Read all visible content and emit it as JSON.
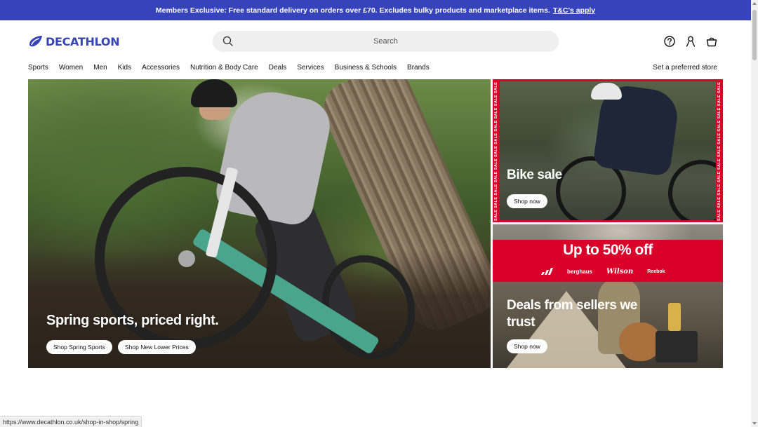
{
  "promo": {
    "text": "Members Exclusive: Free standard delivery on orders over £70. Excludes bulky products and marketplace items.",
    "link": "T&C's apply"
  },
  "brand": {
    "name": "DECATHLON",
    "color": "#3643ba"
  },
  "search": {
    "placeholder": "Search",
    "icon": "search-icon"
  },
  "header_icons": [
    "help-icon",
    "account-icon",
    "basket-icon"
  ],
  "nav": {
    "items": [
      "Sports",
      "Women",
      "Men",
      "Kids",
      "Accessories",
      "Nutrition & Body Care",
      "Deals",
      "Services",
      "Business & Schools",
      "Brands"
    ],
    "store": "Set a preferred store"
  },
  "hero": {
    "headline": "Spring sports, priced right.",
    "button1": "Shop Spring Sports",
    "button2": "Shop New Lower Prices"
  },
  "bike_card": {
    "title": "Bike sale",
    "button": "Shop now",
    "sale_tag": "SALE",
    "accent": "#d9002a"
  },
  "deals_card": {
    "banner": "Up to 50% off",
    "brands": [
      "adidas",
      "berghaus",
      "Wilson",
      "Reebok"
    ],
    "title": "Deals from sellers we trust",
    "button": "Shop now"
  },
  "status_url": "https://www.decathlon.co.uk/shop-in-shop/spring"
}
